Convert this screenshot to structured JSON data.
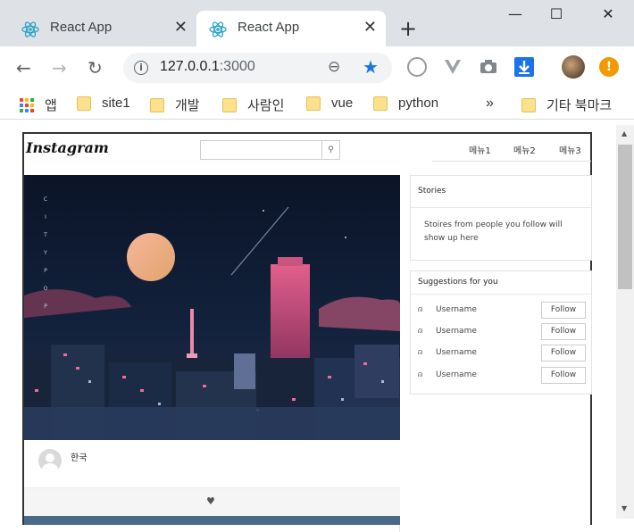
{
  "browser": {
    "tabs": [
      {
        "title": "React App",
        "active": false
      },
      {
        "title": "React App",
        "active": true
      }
    ],
    "new_tab": "+",
    "url_host": "127.0.0.1",
    "url_port": ":3000",
    "bookmarks": [
      {
        "label": "앱",
        "icon": "apps-grid-icon"
      },
      {
        "label": "site1",
        "icon": "folder-icon"
      },
      {
        "label": "개발",
        "icon": "folder-icon"
      },
      {
        "label": "사람인",
        "icon": "folder-icon"
      },
      {
        "label": "vue",
        "icon": "folder-icon"
      },
      {
        "label": "python",
        "icon": "folder-icon"
      },
      {
        "label": "기타 북마크",
        "icon": "folder-icon"
      }
    ],
    "overflow": "»",
    "colors": {
      "tabstrip": "#dee1e6",
      "star": "#1a73e8",
      "warning": "#f29900"
    }
  },
  "app": {
    "logo": "Instagram",
    "search_placeholder": "",
    "menu": [
      "메뉴1",
      "메뉴2",
      "메뉴3"
    ],
    "post": {
      "image_letters": [
        "C",
        "I",
        "T",
        "Y",
        "P",
        "O",
        "P"
      ],
      "caption": "한국",
      "like_icon": "heart-icon"
    },
    "stories": {
      "title": "Stories",
      "body": "Stoires from people you follow will show up here"
    },
    "suggestions": {
      "title": "Suggestions for you",
      "users": [
        {
          "name": "Username",
          "button": "Follow"
        },
        {
          "name": "Username",
          "button": "Follow"
        },
        {
          "name": "Username",
          "button": "Follow"
        },
        {
          "name": "Username",
          "button": "Follow"
        }
      ]
    }
  }
}
